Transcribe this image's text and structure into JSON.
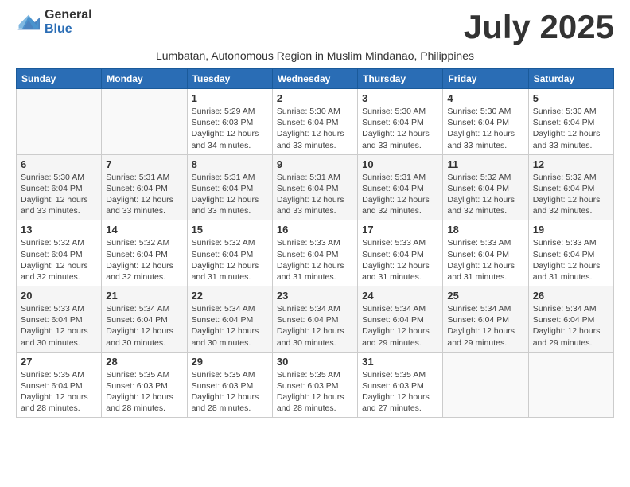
{
  "logo": {
    "general": "General",
    "blue": "Blue"
  },
  "title": "July 2025",
  "subtitle": "Lumbatan, Autonomous Region in Muslim Mindanao, Philippines",
  "weekdays": [
    "Sunday",
    "Monday",
    "Tuesday",
    "Wednesday",
    "Thursday",
    "Friday",
    "Saturday"
  ],
  "weeks": [
    [
      {
        "day": "",
        "sunrise": "",
        "sunset": "",
        "daylight": ""
      },
      {
        "day": "",
        "sunrise": "",
        "sunset": "",
        "daylight": ""
      },
      {
        "day": "1",
        "sunrise": "Sunrise: 5:29 AM",
        "sunset": "Sunset: 6:03 PM",
        "daylight": "Daylight: 12 hours and 34 minutes."
      },
      {
        "day": "2",
        "sunrise": "Sunrise: 5:30 AM",
        "sunset": "Sunset: 6:04 PM",
        "daylight": "Daylight: 12 hours and 33 minutes."
      },
      {
        "day": "3",
        "sunrise": "Sunrise: 5:30 AM",
        "sunset": "Sunset: 6:04 PM",
        "daylight": "Daylight: 12 hours and 33 minutes."
      },
      {
        "day": "4",
        "sunrise": "Sunrise: 5:30 AM",
        "sunset": "Sunset: 6:04 PM",
        "daylight": "Daylight: 12 hours and 33 minutes."
      },
      {
        "day": "5",
        "sunrise": "Sunrise: 5:30 AM",
        "sunset": "Sunset: 6:04 PM",
        "daylight": "Daylight: 12 hours and 33 minutes."
      }
    ],
    [
      {
        "day": "6",
        "sunrise": "Sunrise: 5:30 AM",
        "sunset": "Sunset: 6:04 PM",
        "daylight": "Daylight: 12 hours and 33 minutes."
      },
      {
        "day": "7",
        "sunrise": "Sunrise: 5:31 AM",
        "sunset": "Sunset: 6:04 PM",
        "daylight": "Daylight: 12 hours and 33 minutes."
      },
      {
        "day": "8",
        "sunrise": "Sunrise: 5:31 AM",
        "sunset": "Sunset: 6:04 PM",
        "daylight": "Daylight: 12 hours and 33 minutes."
      },
      {
        "day": "9",
        "sunrise": "Sunrise: 5:31 AM",
        "sunset": "Sunset: 6:04 PM",
        "daylight": "Daylight: 12 hours and 33 minutes."
      },
      {
        "day": "10",
        "sunrise": "Sunrise: 5:31 AM",
        "sunset": "Sunset: 6:04 PM",
        "daylight": "Daylight: 12 hours and 32 minutes."
      },
      {
        "day": "11",
        "sunrise": "Sunrise: 5:32 AM",
        "sunset": "Sunset: 6:04 PM",
        "daylight": "Daylight: 12 hours and 32 minutes."
      },
      {
        "day": "12",
        "sunrise": "Sunrise: 5:32 AM",
        "sunset": "Sunset: 6:04 PM",
        "daylight": "Daylight: 12 hours and 32 minutes."
      }
    ],
    [
      {
        "day": "13",
        "sunrise": "Sunrise: 5:32 AM",
        "sunset": "Sunset: 6:04 PM",
        "daylight": "Daylight: 12 hours and 32 minutes."
      },
      {
        "day": "14",
        "sunrise": "Sunrise: 5:32 AM",
        "sunset": "Sunset: 6:04 PM",
        "daylight": "Daylight: 12 hours and 32 minutes."
      },
      {
        "day": "15",
        "sunrise": "Sunrise: 5:32 AM",
        "sunset": "Sunset: 6:04 PM",
        "daylight": "Daylight: 12 hours and 31 minutes."
      },
      {
        "day": "16",
        "sunrise": "Sunrise: 5:33 AM",
        "sunset": "Sunset: 6:04 PM",
        "daylight": "Daylight: 12 hours and 31 minutes."
      },
      {
        "day": "17",
        "sunrise": "Sunrise: 5:33 AM",
        "sunset": "Sunset: 6:04 PM",
        "daylight": "Daylight: 12 hours and 31 minutes."
      },
      {
        "day": "18",
        "sunrise": "Sunrise: 5:33 AM",
        "sunset": "Sunset: 6:04 PM",
        "daylight": "Daylight: 12 hours and 31 minutes."
      },
      {
        "day": "19",
        "sunrise": "Sunrise: 5:33 AM",
        "sunset": "Sunset: 6:04 PM",
        "daylight": "Daylight: 12 hours and 31 minutes."
      }
    ],
    [
      {
        "day": "20",
        "sunrise": "Sunrise: 5:33 AM",
        "sunset": "Sunset: 6:04 PM",
        "daylight": "Daylight: 12 hours and 30 minutes."
      },
      {
        "day": "21",
        "sunrise": "Sunrise: 5:34 AM",
        "sunset": "Sunset: 6:04 PM",
        "daylight": "Daylight: 12 hours and 30 minutes."
      },
      {
        "day": "22",
        "sunrise": "Sunrise: 5:34 AM",
        "sunset": "Sunset: 6:04 PM",
        "daylight": "Daylight: 12 hours and 30 minutes."
      },
      {
        "day": "23",
        "sunrise": "Sunrise: 5:34 AM",
        "sunset": "Sunset: 6:04 PM",
        "daylight": "Daylight: 12 hours and 30 minutes."
      },
      {
        "day": "24",
        "sunrise": "Sunrise: 5:34 AM",
        "sunset": "Sunset: 6:04 PM",
        "daylight": "Daylight: 12 hours and 29 minutes."
      },
      {
        "day": "25",
        "sunrise": "Sunrise: 5:34 AM",
        "sunset": "Sunset: 6:04 PM",
        "daylight": "Daylight: 12 hours and 29 minutes."
      },
      {
        "day": "26",
        "sunrise": "Sunrise: 5:34 AM",
        "sunset": "Sunset: 6:04 PM",
        "daylight": "Daylight: 12 hours and 29 minutes."
      }
    ],
    [
      {
        "day": "27",
        "sunrise": "Sunrise: 5:35 AM",
        "sunset": "Sunset: 6:04 PM",
        "daylight": "Daylight: 12 hours and 28 minutes."
      },
      {
        "day": "28",
        "sunrise": "Sunrise: 5:35 AM",
        "sunset": "Sunset: 6:03 PM",
        "daylight": "Daylight: 12 hours and 28 minutes."
      },
      {
        "day": "29",
        "sunrise": "Sunrise: 5:35 AM",
        "sunset": "Sunset: 6:03 PM",
        "daylight": "Daylight: 12 hours and 28 minutes."
      },
      {
        "day": "30",
        "sunrise": "Sunrise: 5:35 AM",
        "sunset": "Sunset: 6:03 PM",
        "daylight": "Daylight: 12 hours and 28 minutes."
      },
      {
        "day": "31",
        "sunrise": "Sunrise: 5:35 AM",
        "sunset": "Sunset: 6:03 PM",
        "daylight": "Daylight: 12 hours and 27 minutes."
      },
      {
        "day": "",
        "sunrise": "",
        "sunset": "",
        "daylight": ""
      },
      {
        "day": "",
        "sunrise": "",
        "sunset": "",
        "daylight": ""
      }
    ]
  ]
}
